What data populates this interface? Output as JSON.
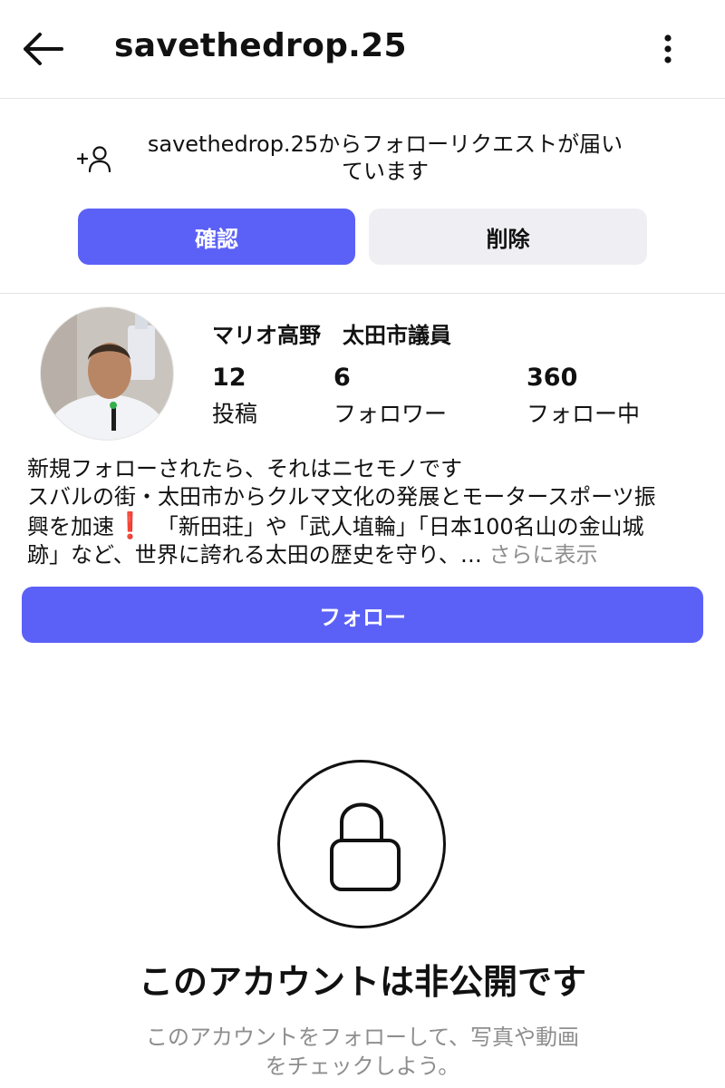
{
  "header": {
    "title": "savethedrop.25",
    "back_icon": "arrow-left-icon",
    "more_icon": "more-vertical-icon"
  },
  "request": {
    "icon": "add-person-icon",
    "text_line1": "savethedrop.25からフォローリクエストが届い",
    "text_line2": "ています",
    "confirm_label": "確認",
    "delete_label": "削除"
  },
  "profile": {
    "name": "マリオ高野　太田市議員",
    "stats": [
      {
        "value": "12",
        "label": "投稿"
      },
      {
        "value": "6",
        "label": "フォロワー"
      },
      {
        "value": "360",
        "label": "フォロー中"
      }
    ],
    "bio_lines": [
      "新規フォローされたら、それはニセモノです",
      "スバルの街・太田市からクルマ文化の発展とモータースポーツ振",
      "興を加速",
      "　「新田荘」や「武人埴輪」「日本100名山の金山城",
      "跡」など、世界に誇れる太田の歴史を守り、… "
    ],
    "bio_exclamation": "❗",
    "more_label": "さらに表示",
    "follow_label": "フォロー"
  },
  "private": {
    "icon": "lock-icon",
    "title": "このアカウントは非公開です",
    "subtitle_line1": "このアカウントをフォローして、写真や動画",
    "subtitle_line2": "をチェックしよう。"
  },
  "colors": {
    "primary": "#5b61f6",
    "secondary_button": "#efeff3",
    "muted_text": "#8e8e8e",
    "exclamation": "#d81e1e"
  }
}
